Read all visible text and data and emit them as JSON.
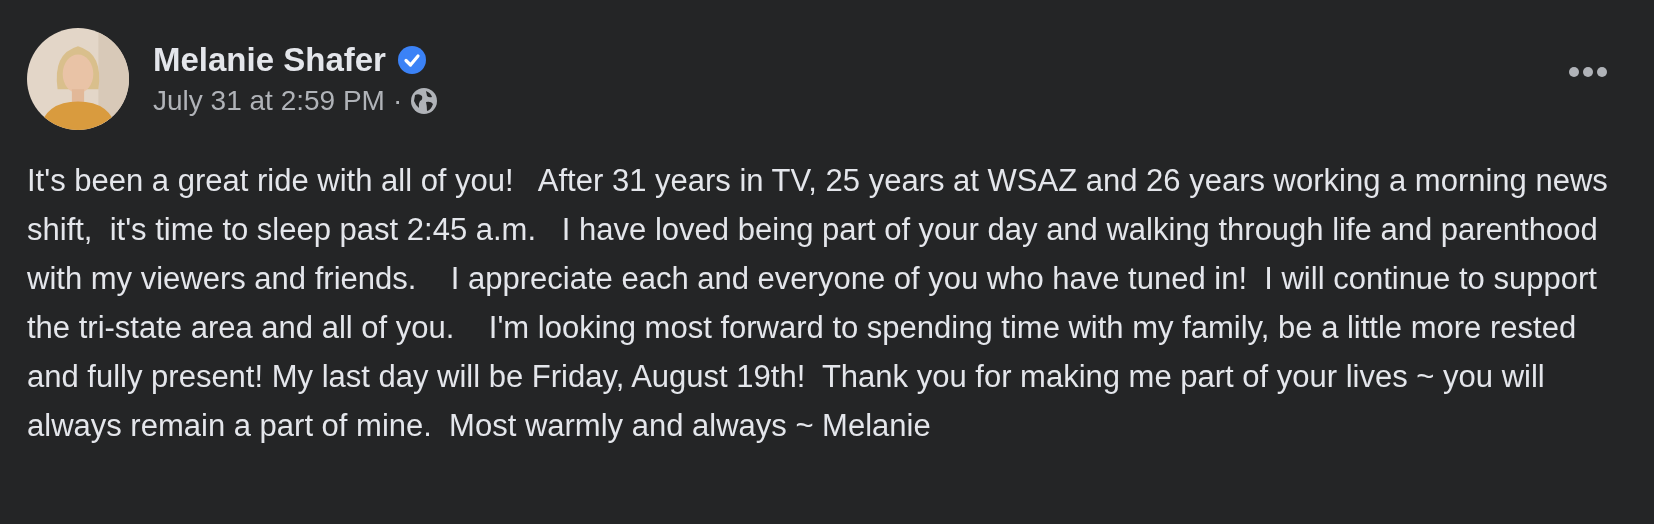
{
  "post": {
    "author": "Melanie Shafer",
    "verified": true,
    "timestamp": "July 31 at 2:59 PM",
    "separator": "·",
    "text": "It's been a great ride with all of you!   After 31 years in TV, 25 years at WSAZ and 26 years working a morning news shift,  it's time to sleep past 2:45 a.m.   I have loved being part of your day and walking through life and parenthood with my viewers and friends.    I appreciate each and everyone of you who have tuned in!  I will continue to support the tri-state area and all of you.    I'm looking most forward to spending time with my family, be a little more rested and fully present! My last day will be Friday, August 19th!  Thank you for making me part of your lives ~ you will always remain a part of mine.  Most warmly and always ~ Melanie"
  }
}
